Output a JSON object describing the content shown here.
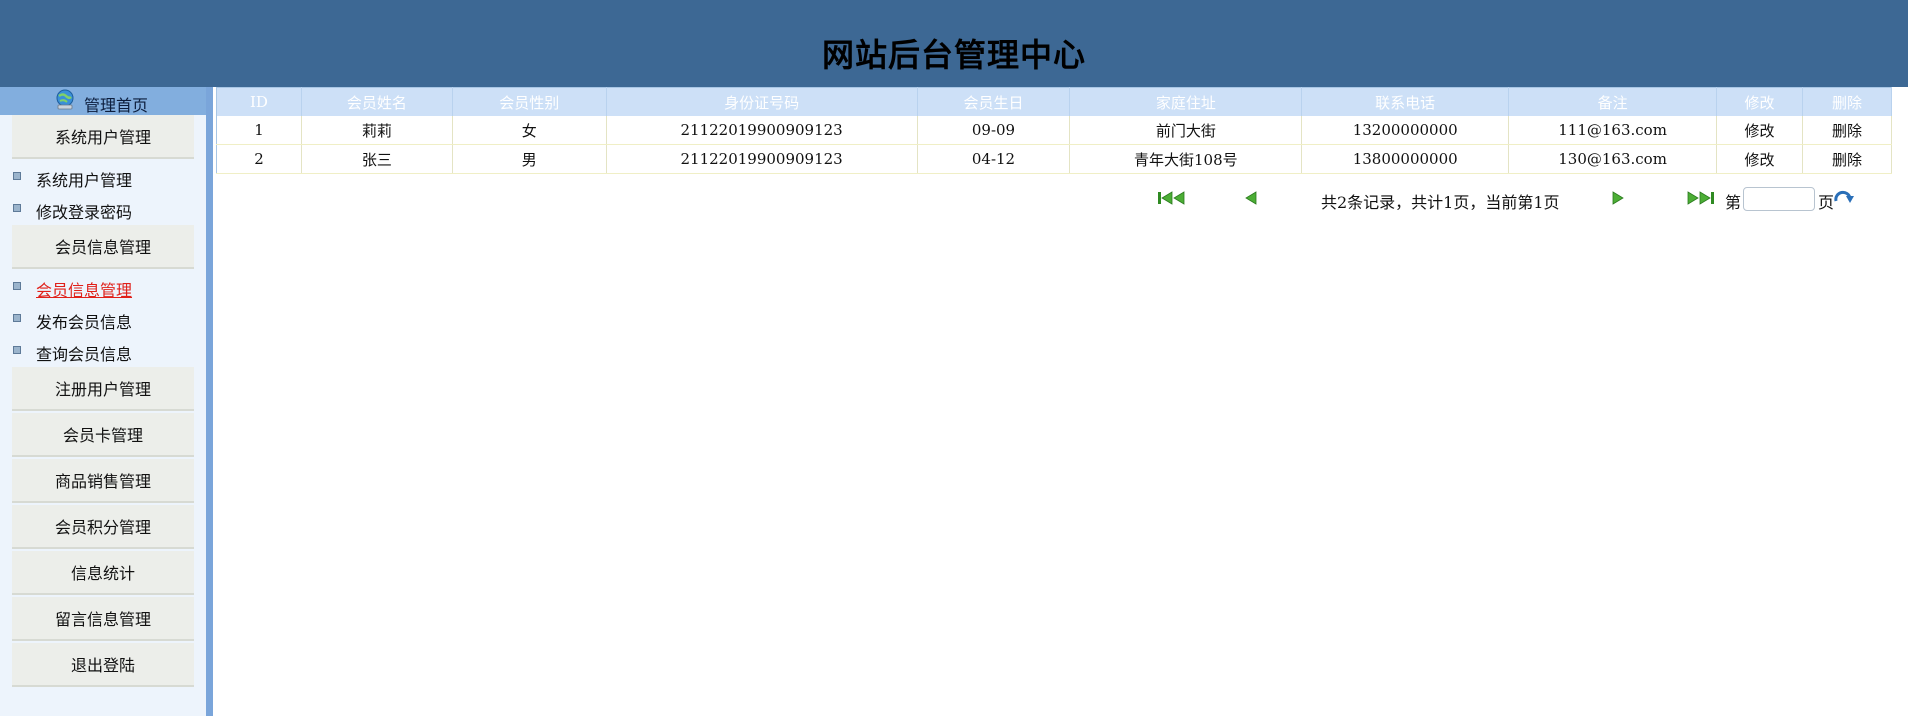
{
  "header": {
    "title": "网站后台管理中心"
  },
  "sidebar": {
    "home": "管理首页",
    "sections": [
      {
        "title": "系统用户管理",
        "items": [
          {
            "label": "系统用户管理"
          },
          {
            "label": "修改登录密码"
          }
        ]
      },
      {
        "title": "会员信息管理",
        "items": [
          {
            "label": "会员信息管理",
            "active": true
          },
          {
            "label": "发布会员信息"
          },
          {
            "label": "查询会员信息"
          }
        ]
      },
      {
        "title": "注册用户管理",
        "items": []
      },
      {
        "title": "会员卡管理",
        "items": []
      },
      {
        "title": "商品销售管理",
        "items": []
      },
      {
        "title": "会员积分管理",
        "items": []
      },
      {
        "title": "信息统计",
        "items": []
      },
      {
        "title": "留言信息管理",
        "items": []
      },
      {
        "title": "退出登陆",
        "items": []
      }
    ]
  },
  "table": {
    "columns": [
      "ID",
      "会员姓名",
      "会员性别",
      "身份证号码",
      "会员生日",
      "家庭住址",
      "联系电话",
      "备注",
      "修改",
      "删除"
    ],
    "rows": [
      [
        "1",
        "莉莉",
        "女",
        "21122019900909123",
        "09-09",
        "前门大街",
        "13200000000",
        "111@163.com",
        "修改",
        "删除"
      ],
      [
        "2",
        "张三",
        "男",
        "21122019900909123",
        "04-12",
        "青年大街108号",
        "13800000000",
        "130@163.com",
        "修改",
        "删除"
      ]
    ]
  },
  "pager": {
    "info": "共2条记录，共计1页，当前第1页",
    "di_label": "第",
    "ye_label": "页",
    "page_input_value": "",
    "icons": [
      "first-page-icon",
      "prev-page-icon",
      "next-page-icon",
      "last-page-icon",
      "go-page-icon"
    ],
    "icon_color": "#3a9a2a"
  },
  "colors": {
    "header_bg": "#3d6894",
    "sidebar_bg": "#edf4fc",
    "table_header_bg": "#cde0f7",
    "active_link": "#e0201a"
  }
}
